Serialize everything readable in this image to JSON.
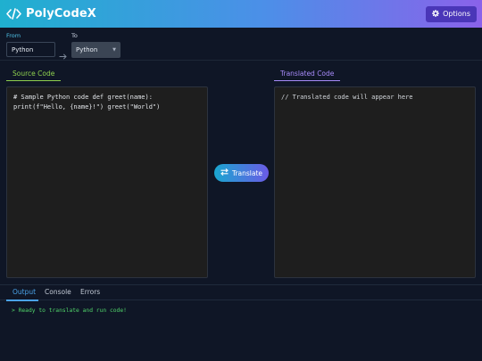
{
  "app": {
    "name": "PolyCodeX",
    "logo_icon": "code-brackets-icon",
    "options_label": "Options",
    "options_icon": "gear-icon",
    "header_gradient": [
      "#1fb0cf",
      "#8a62ea"
    ]
  },
  "languages": {
    "from_label": "From",
    "from_value": "Python",
    "to_label": "To",
    "to_value": "Python"
  },
  "editor": {
    "source_tab": "Source Code",
    "target_tab": "Translated Code",
    "source_code": "# Sample Python code def greet(name): print(f\"Hello, {name}!\") greet(\"World\")",
    "translated_placeholder": "// Translated code will appear here"
  },
  "translate": {
    "label": "Translate",
    "icon": "swap-arrows-icon"
  },
  "output": {
    "tabs": [
      "Output",
      "Console",
      "Errors"
    ],
    "active_tab": "Output",
    "message": "> Ready to translate and run code!"
  },
  "colors": {
    "source_accent": "#8fd14f",
    "target_accent": "#a78bfa",
    "output_accent": "#4aa3e8",
    "success_text": "#50d46a"
  }
}
